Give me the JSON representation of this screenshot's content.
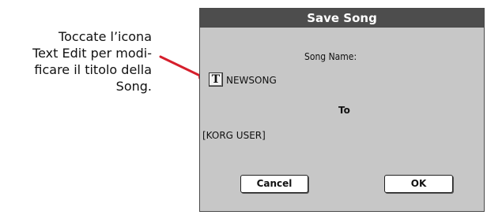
{
  "callout": {
    "lines": [
      "Toccate l’icona",
      "Text Edit per modi-",
      "ficare il titolo della",
      "Song."
    ],
    "accent_color": "#d61f2c"
  },
  "dialog": {
    "title": "Save Song",
    "song_name_label": "Song Name:",
    "text_edit_icon_glyph": "T",
    "text_edit_icon_name": "text-edit-icon",
    "song_name_value": "NEWSONG",
    "to_label": "To",
    "destination_value": "[KORG USER]",
    "cancel_label": "Cancel",
    "ok_label": "OK"
  }
}
